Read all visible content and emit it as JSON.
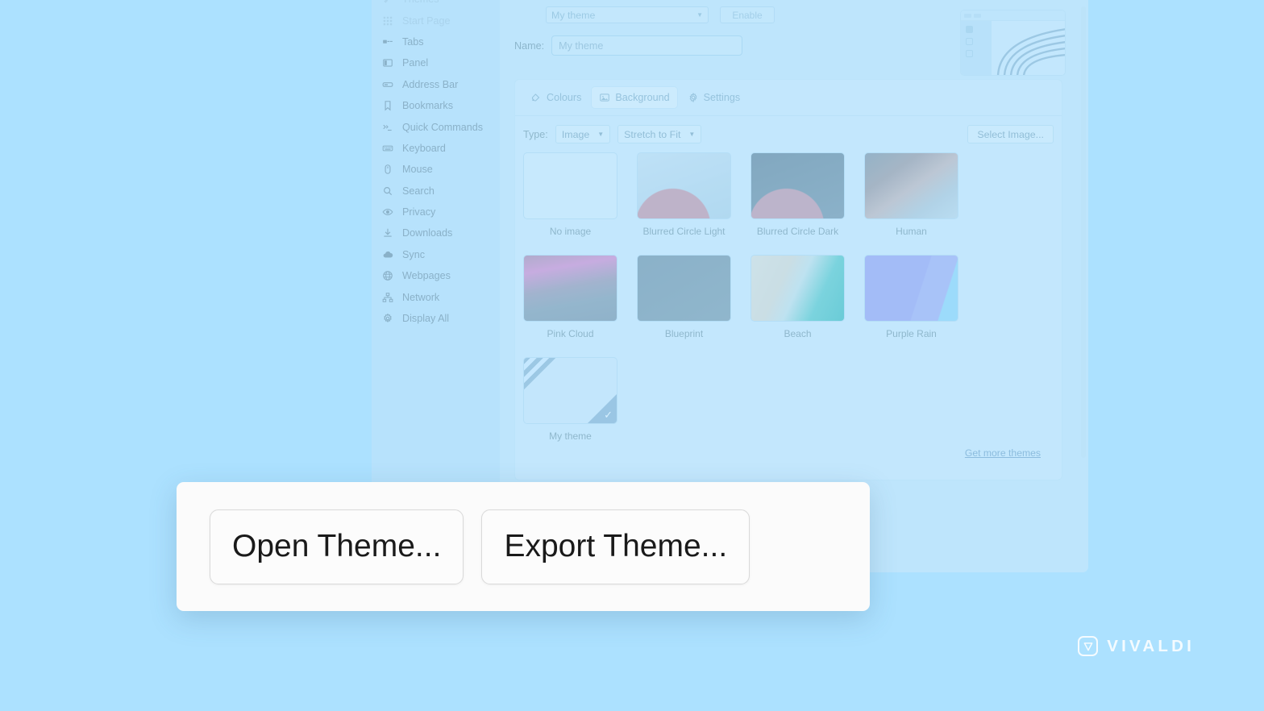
{
  "background_color": "#ace1ff",
  "settings_window": {
    "sidebar": {
      "items": [
        {
          "label": "Themes",
          "icon": "brush-icon",
          "dim": true
        },
        {
          "label": "Start Page",
          "icon": "grid-icon",
          "dim": true
        },
        {
          "label": "Tabs",
          "icon": "tabs-icon",
          "dim": false
        },
        {
          "label": "Panel",
          "icon": "panel-icon",
          "dim": false
        },
        {
          "label": "Address Bar",
          "icon": "address-bar-icon",
          "dim": false
        },
        {
          "label": "Bookmarks",
          "icon": "bookmark-icon",
          "dim": false
        },
        {
          "label": "Quick Commands",
          "icon": "terminal-icon",
          "dim": false
        },
        {
          "label": "Keyboard",
          "icon": "keyboard-icon",
          "dim": false
        },
        {
          "label": "Mouse",
          "icon": "mouse-icon",
          "dim": false
        },
        {
          "label": "Search",
          "icon": "search-icon",
          "dim": false
        },
        {
          "label": "Privacy",
          "icon": "eye-icon",
          "dim": false
        },
        {
          "label": "Downloads",
          "icon": "download-icon",
          "dim": false
        },
        {
          "label": "Sync",
          "icon": "cloud-icon",
          "dim": false
        },
        {
          "label": "Webpages",
          "icon": "globe-icon",
          "dim": false
        },
        {
          "label": "Network",
          "icon": "network-icon",
          "dim": false
        },
        {
          "label": "Display All",
          "icon": "gear-icon",
          "dim": false
        }
      ]
    },
    "topbar": {
      "theme_select_value": "My theme",
      "action_button_label": "Enable",
      "name_label": "Name:",
      "name_value": "My theme"
    },
    "tabs": [
      {
        "label": "Colours",
        "icon": "paint-bucket-icon",
        "active": false
      },
      {
        "label": "Background",
        "icon": "image-icon",
        "active": true
      },
      {
        "label": "Settings",
        "icon": "gear-icon",
        "active": false
      }
    ],
    "toolbar": {
      "type_label": "Type:",
      "type_value": "Image",
      "fit_value": "Stretch to Fit",
      "select_image_label": "Select Image..."
    },
    "thumbnails": [
      {
        "caption": "No image",
        "style": "none",
        "selected": false
      },
      {
        "caption": "Blurred Circle Light",
        "style": "blc-light",
        "selected": false
      },
      {
        "caption": "Blurred Circle Dark",
        "style": "blc-dark",
        "selected": false
      },
      {
        "caption": "Human",
        "style": "human",
        "selected": false
      },
      {
        "caption": "Pink Cloud",
        "style": "pink-cloud",
        "selected": false
      },
      {
        "caption": "Blueprint",
        "style": "blueprint",
        "selected": false
      },
      {
        "caption": "Beach",
        "style": "beach",
        "selected": false
      },
      {
        "caption": "Purple Rain",
        "style": "purple-rain",
        "selected": false
      },
      {
        "caption": "My theme",
        "style": "my-theme",
        "selected": true
      }
    ],
    "get_more_themes_label": "Get more themes"
  },
  "overlay": {
    "open_theme_label": "Open Theme...",
    "export_theme_label": "Export Theme..."
  },
  "branding": {
    "wordmark": "VIVALDI"
  }
}
